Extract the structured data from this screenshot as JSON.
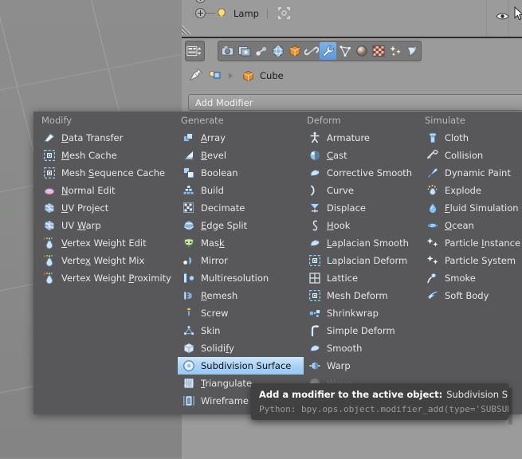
{
  "app": "Blender",
  "viewport": {
    "name": "3d-viewport"
  },
  "outliner": {
    "rows": [
      {
        "label": "Lamp",
        "icon": "lamp-icon",
        "expand": "plus-icon",
        "select_icon": "select-box-icon"
      }
    ],
    "visibility_icon": "eye-icon",
    "cursor_icon": "mouse-cursor-icon"
  },
  "properties": {
    "tabs_left": [
      {
        "name": "tab-editor-type",
        "icon": "editor-type-icon",
        "active": false
      }
    ],
    "tabs": [
      {
        "name": "tab-render",
        "icon": "camera-icon",
        "label": "Render",
        "active": false
      },
      {
        "name": "tab-render-layers",
        "icon": "render-layers-icon",
        "label": "Render Layers",
        "active": false
      },
      {
        "name": "tab-scene",
        "icon": "scene-icon",
        "label": "Scene",
        "active": false
      },
      {
        "name": "tab-world",
        "icon": "world-globe-icon",
        "label": "World",
        "active": false
      },
      {
        "name": "tab-object",
        "icon": "object-cube-icon",
        "label": "Object",
        "active": false
      },
      {
        "name": "tab-constraints",
        "icon": "chain-link-icon",
        "label": "Constraints",
        "active": false
      },
      {
        "name": "tab-modifiers",
        "icon": "wrench-icon",
        "label": "Modifiers",
        "active": true
      },
      {
        "name": "tab-object-data",
        "icon": "mesh-data-icon",
        "label": "Object Data",
        "active": false
      },
      {
        "name": "tab-material",
        "icon": "material-sphere-icon",
        "label": "Material",
        "active": false
      },
      {
        "name": "tab-texture",
        "icon": "texture-checker-icon",
        "label": "Texture",
        "active": false
      },
      {
        "name": "tab-particles",
        "icon": "particles-icon",
        "label": "Particles",
        "active": false
      },
      {
        "name": "tab-physics",
        "icon": "physics-icon",
        "label": "Physics",
        "active": false
      }
    ],
    "breadcrumb": {
      "pin_icon": "pin-icon",
      "browse_icon": "browse-object-icon",
      "arrow_icon": "chevron-right-icon",
      "object_icon": "object-cube-icon",
      "object_name": "Cube"
    },
    "add_modifier_label": "Add Modifier"
  },
  "menu": {
    "columns": [
      {
        "header": "Modify",
        "items": [
          {
            "label": "Data Transfer",
            "accel": "D",
            "icon": "data-transfer-icon"
          },
          {
            "label": "Mesh Cache",
            "accel": "M",
            "icon": "mesh-cache-icon"
          },
          {
            "label": "Mesh Sequence Cache",
            "accel": "S",
            "icon": "mesh-sequence-cache-icon"
          },
          {
            "label": "Normal Edit",
            "accel": "N",
            "icon": "normal-edit-icon"
          },
          {
            "label": "UV Project",
            "accel": "U",
            "icon": "uv-project-icon"
          },
          {
            "label": "UV Warp",
            "accel": "W",
            "icon": "uv-warp-icon"
          },
          {
            "label": "Vertex Weight Edit",
            "accel": "V",
            "icon": "vertex-weight-edit-icon"
          },
          {
            "label": "Vertex Weight Mix",
            "accel": "x",
            "icon": "vertex-weight-mix-icon"
          },
          {
            "label": "Vertex Weight Proximity",
            "accel": "P",
            "icon": "vertex-weight-proximity-icon"
          }
        ]
      },
      {
        "header": "Generate",
        "items": [
          {
            "label": "Array",
            "accel": "A",
            "icon": "array-icon"
          },
          {
            "label": "Bevel",
            "accel": "B",
            "icon": "bevel-icon"
          },
          {
            "label": "Boolean",
            "accel": "",
            "icon": "boolean-icon"
          },
          {
            "label": "Build",
            "accel": "",
            "icon": "build-icon"
          },
          {
            "label": "Decimate",
            "accel": "",
            "icon": "decimate-icon"
          },
          {
            "label": "Edge Split",
            "accel": "E",
            "icon": "edge-split-icon"
          },
          {
            "label": "Mask",
            "accel": "k",
            "icon": "mask-icon"
          },
          {
            "label": "Mirror",
            "accel": "",
            "icon": "mirror-icon"
          },
          {
            "label": "Multiresolution",
            "accel": "",
            "icon": "multiresolution-icon"
          },
          {
            "label": "Remesh",
            "accel": "R",
            "icon": "remesh-icon"
          },
          {
            "label": "Screw",
            "accel": "",
            "icon": "screw-icon"
          },
          {
            "label": "Skin",
            "accel": "",
            "icon": "skin-icon"
          },
          {
            "label": "Solidify",
            "accel": "f",
            "icon": "solidify-icon"
          },
          {
            "label": "Subdivision Surface",
            "accel": "",
            "icon": "subdivision-surface-icon",
            "selected": true
          },
          {
            "label": "Triangulate",
            "accel": "T",
            "icon": "triangulate-icon"
          },
          {
            "label": "Wireframe",
            "accel": "",
            "icon": "wireframe-icon"
          }
        ]
      },
      {
        "header": "Deform",
        "items": [
          {
            "label": "Armature",
            "accel": "",
            "icon": "armature-icon"
          },
          {
            "label": "Cast",
            "accel": "C",
            "icon": "cast-icon"
          },
          {
            "label": "Corrective Smooth",
            "accel": "",
            "icon": "corrective-smooth-icon"
          },
          {
            "label": "Curve",
            "accel": "",
            "icon": "curve-icon"
          },
          {
            "label": "Displace",
            "accel": "",
            "icon": "displace-icon"
          },
          {
            "label": "Hook",
            "accel": "H",
            "icon": "hook-icon"
          },
          {
            "label": "Laplacian Smooth",
            "accel": "L",
            "icon": "laplacian-smooth-icon"
          },
          {
            "label": "Laplacian Deform",
            "accel": "",
            "icon": "laplacian-deform-icon"
          },
          {
            "label": "Lattice",
            "accel": "",
            "icon": "lattice-icon"
          },
          {
            "label": "Mesh Deform",
            "accel": "",
            "icon": "mesh-deform-icon"
          },
          {
            "label": "Shrinkwrap",
            "accel": "",
            "icon": "shrinkwrap-icon"
          },
          {
            "label": "Simple Deform",
            "accel": "",
            "icon": "simple-deform-icon"
          },
          {
            "label": "Smooth",
            "accel": "",
            "icon": "smooth-icon"
          },
          {
            "label": "Warp",
            "accel": "",
            "icon": "warp-icon"
          },
          {
            "label": "Wave",
            "accel": "",
            "icon": "wave-icon",
            "occluded": true
          }
        ]
      },
      {
        "header": "Simulate",
        "items": [
          {
            "label": "Cloth",
            "accel": "",
            "icon": "cloth-icon"
          },
          {
            "label": "Collision",
            "accel": "",
            "icon": "collision-icon"
          },
          {
            "label": "Dynamic Paint",
            "accel": "",
            "icon": "dynamic-paint-icon"
          },
          {
            "label": "Explode",
            "accel": "",
            "icon": "explode-icon"
          },
          {
            "label": "Fluid Simulation",
            "accel": "F",
            "icon": "fluid-simulation-icon"
          },
          {
            "label": "Ocean",
            "accel": "O",
            "icon": "ocean-icon"
          },
          {
            "label": "Particle Instance",
            "accel": "I",
            "icon": "particle-instance-icon"
          },
          {
            "label": "Particle System",
            "accel": "",
            "icon": "particle-system-icon"
          },
          {
            "label": "Smoke",
            "accel": "",
            "icon": "smoke-icon"
          },
          {
            "label": "Soft Body",
            "accel": "",
            "icon": "soft-body-icon"
          }
        ]
      }
    ]
  },
  "tooltip": {
    "description": "Add a modifier to the active object:",
    "value": "Subdivision Surface",
    "python": "Python: bpy.ops.object.modifier_add(type='SUBSURF')"
  },
  "colors": {
    "menu_bg": "#58585a",
    "highlight": "#a9d2f4",
    "tab_active": "#6ba3de",
    "tooltip_bg": "#414142",
    "panel_bg": "#9b9b9b",
    "viewport_bg": "#8a8a8a"
  }
}
